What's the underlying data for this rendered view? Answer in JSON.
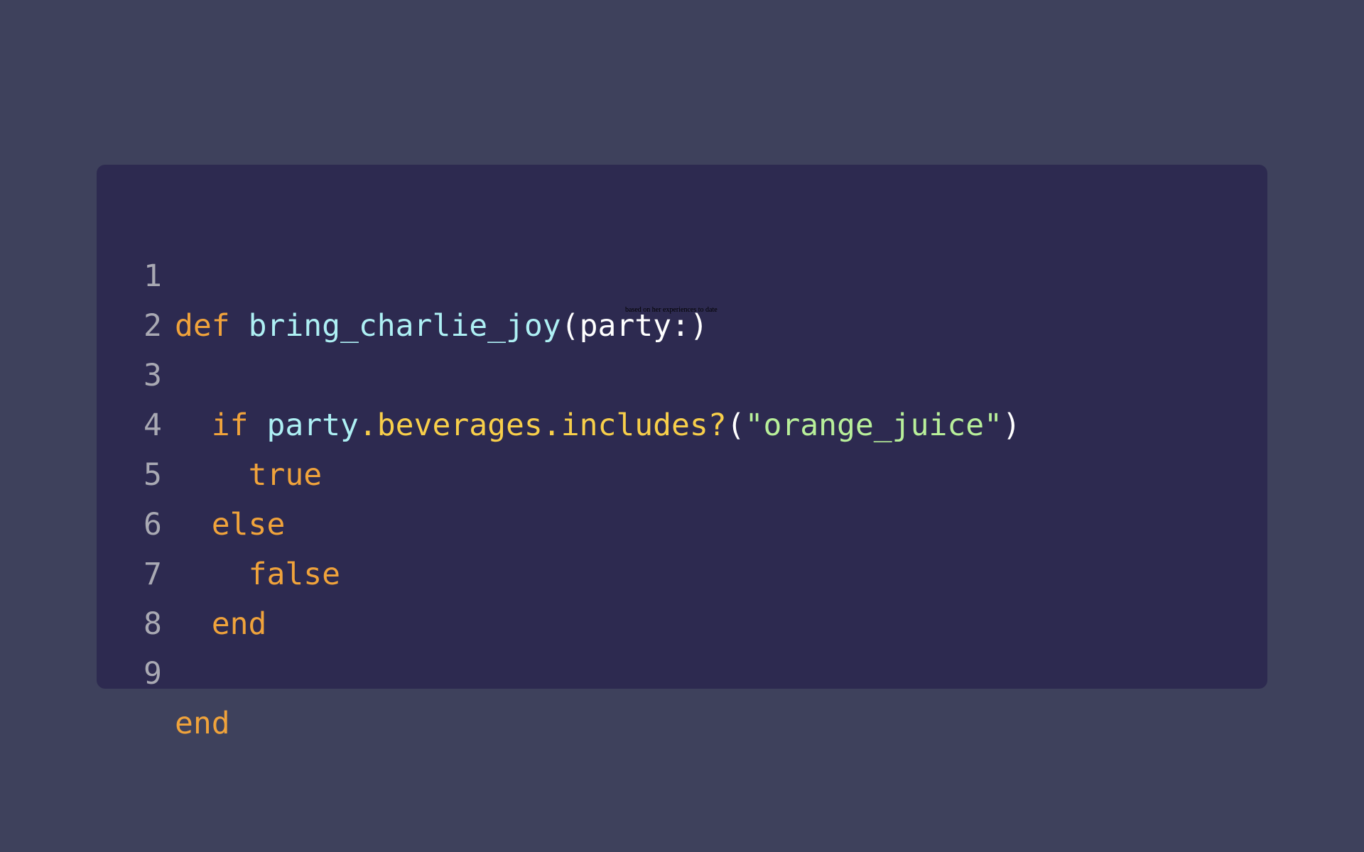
{
  "editor": {
    "lines": [
      {
        "number": "1",
        "indent": "",
        "tokens": {
          "kw": "def",
          "space": " ",
          "fn": "bring_charlie_joy",
          "open": "(",
          "param": "party:",
          "close": ")"
        }
      },
      {
        "number": "2",
        "indent": ""
      },
      {
        "number": "3",
        "indent": "  ",
        "tokens": {
          "kw": "if",
          "space": " ",
          "obj": "party",
          "dot1": ".",
          "method1": "beverages",
          "dot2": ".",
          "method2": "includes?",
          "open": "(",
          "str": "\"orange_juice\"",
          "close": ")"
        }
      },
      {
        "number": "4",
        "indent": "    ",
        "tokens": {
          "kw": "true"
        }
      },
      {
        "number": "5",
        "indent": "  ",
        "tokens": {
          "kw": "else"
        }
      },
      {
        "number": "6",
        "indent": "    ",
        "tokens": {
          "kw": "false"
        }
      },
      {
        "number": "7",
        "indent": "  ",
        "tokens": {
          "kw": "end"
        }
      },
      {
        "number": "8",
        "indent": ""
      },
      {
        "number": "9",
        "indent": "",
        "tokens": {
          "kw": "end"
        }
      }
    ],
    "tooltip_text": "based on her experiences to date"
  },
  "colors": {
    "background": "#3e415c",
    "card": "#2d2a50",
    "keyword": "#f0a33b",
    "function": "#aef0f4",
    "method": "#f8cf4a",
    "string": "#b8ef9a",
    "line_number": "#a9a9b3",
    "default_text": "#ffffff"
  }
}
